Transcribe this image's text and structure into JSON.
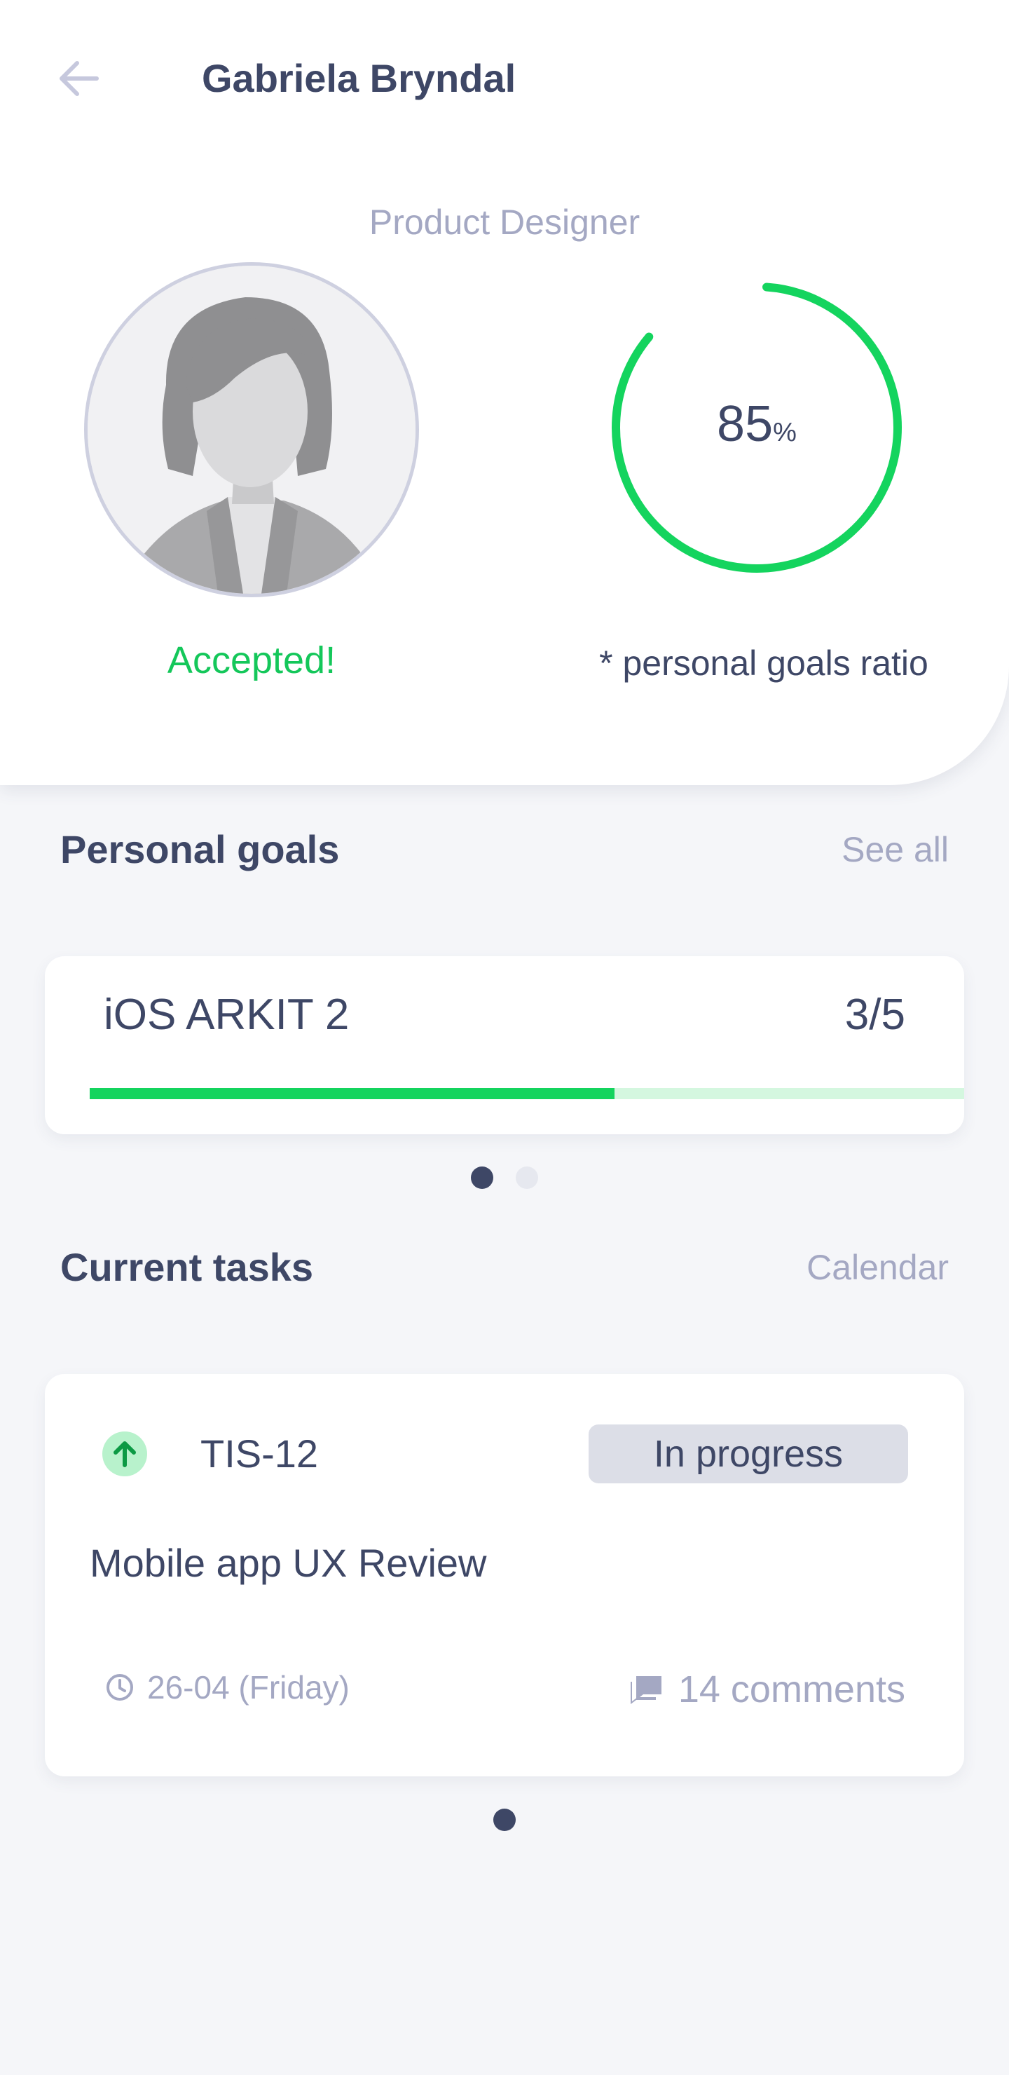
{
  "header": {
    "back_icon": "arrow-left-icon",
    "title": "Gabriela Bryndal"
  },
  "profile": {
    "role": "Product Designer",
    "avatar_icon": "person-silhouette-icon",
    "status": "Accepted!",
    "status_color": "#14c75a",
    "goals_ratio_value": "85",
    "goals_ratio_unit": "%",
    "goals_ratio_percent": 85,
    "goals_ratio_caption": "* personal goals ratio",
    "ring_color": "#14d45e"
  },
  "personal_goals": {
    "title": "Personal goals",
    "link": "See all",
    "goal": {
      "name": "iOS ARKIT 2",
      "count": "3/5",
      "progress_fraction": 0.6,
      "bar_color": "#14d45e",
      "track_color": "#d4f7df"
    },
    "pager": {
      "count": 2,
      "active_index": 0
    }
  },
  "current_tasks": {
    "title": "Current tasks",
    "link": "Calendar",
    "task": {
      "priority_icon": "arrow-up-icon",
      "id": "TIS-12",
      "status": "In progress",
      "name": "Mobile app UX Review",
      "date_icon": "clock-icon",
      "date": "26-04 (Friday)",
      "comments_icon": "comments-icon",
      "comments": "14 comments"
    },
    "pager": {
      "count": 1,
      "active_index": 0
    }
  },
  "colors": {
    "text_primary": "#3e4766",
    "text_muted": "#a4a8c3",
    "background": "#f5f6f9",
    "accent_green": "#14d45e"
  }
}
